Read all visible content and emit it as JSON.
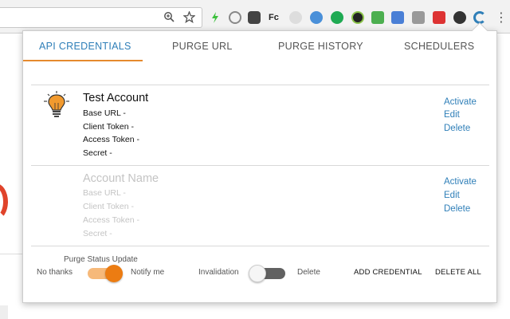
{
  "tabs": [
    {
      "label": "API CREDENTIALS",
      "active": true
    },
    {
      "label": "PURGE URL",
      "active": false
    },
    {
      "label": "PURGE HISTORY",
      "active": false
    },
    {
      "label": "SCHEDULERS",
      "active": false
    }
  ],
  "accounts": [
    {
      "name": "Test Account",
      "fields": [
        "Base URL -",
        "Client Token -",
        "Access Token -",
        "Secret -"
      ],
      "actions": [
        "Activate",
        "Edit",
        "Delete"
      ],
      "icon": "lightbulb-icon",
      "placeholder": false
    },
    {
      "name": "Account Name",
      "fields": [
        "Base URL -",
        "Client Token -",
        "Access Token -",
        "Secret -"
      ],
      "actions": [
        "Activate",
        "Edit",
        "Delete"
      ],
      "placeholder": true
    }
  ],
  "footer": {
    "purge_status_title": "Purge Status Update",
    "no_thanks": "No thanks",
    "notify_me": "Notify me",
    "notify_toggle_on": true,
    "invalidation": "Invalidation",
    "delete": "Delete",
    "purge_type_toggle_on": false,
    "add_credential": "ADD CREDENTIAL",
    "delete_all": "DELETE ALL"
  },
  "colors": {
    "accent_blue": "#2f7fb8",
    "accent_orange": "#ec7c12"
  },
  "toolbar": {
    "icons": [
      "zoom-icon",
      "bookmark-star-icon",
      "extension-icons",
      "chrome-menu-icon"
    ]
  }
}
